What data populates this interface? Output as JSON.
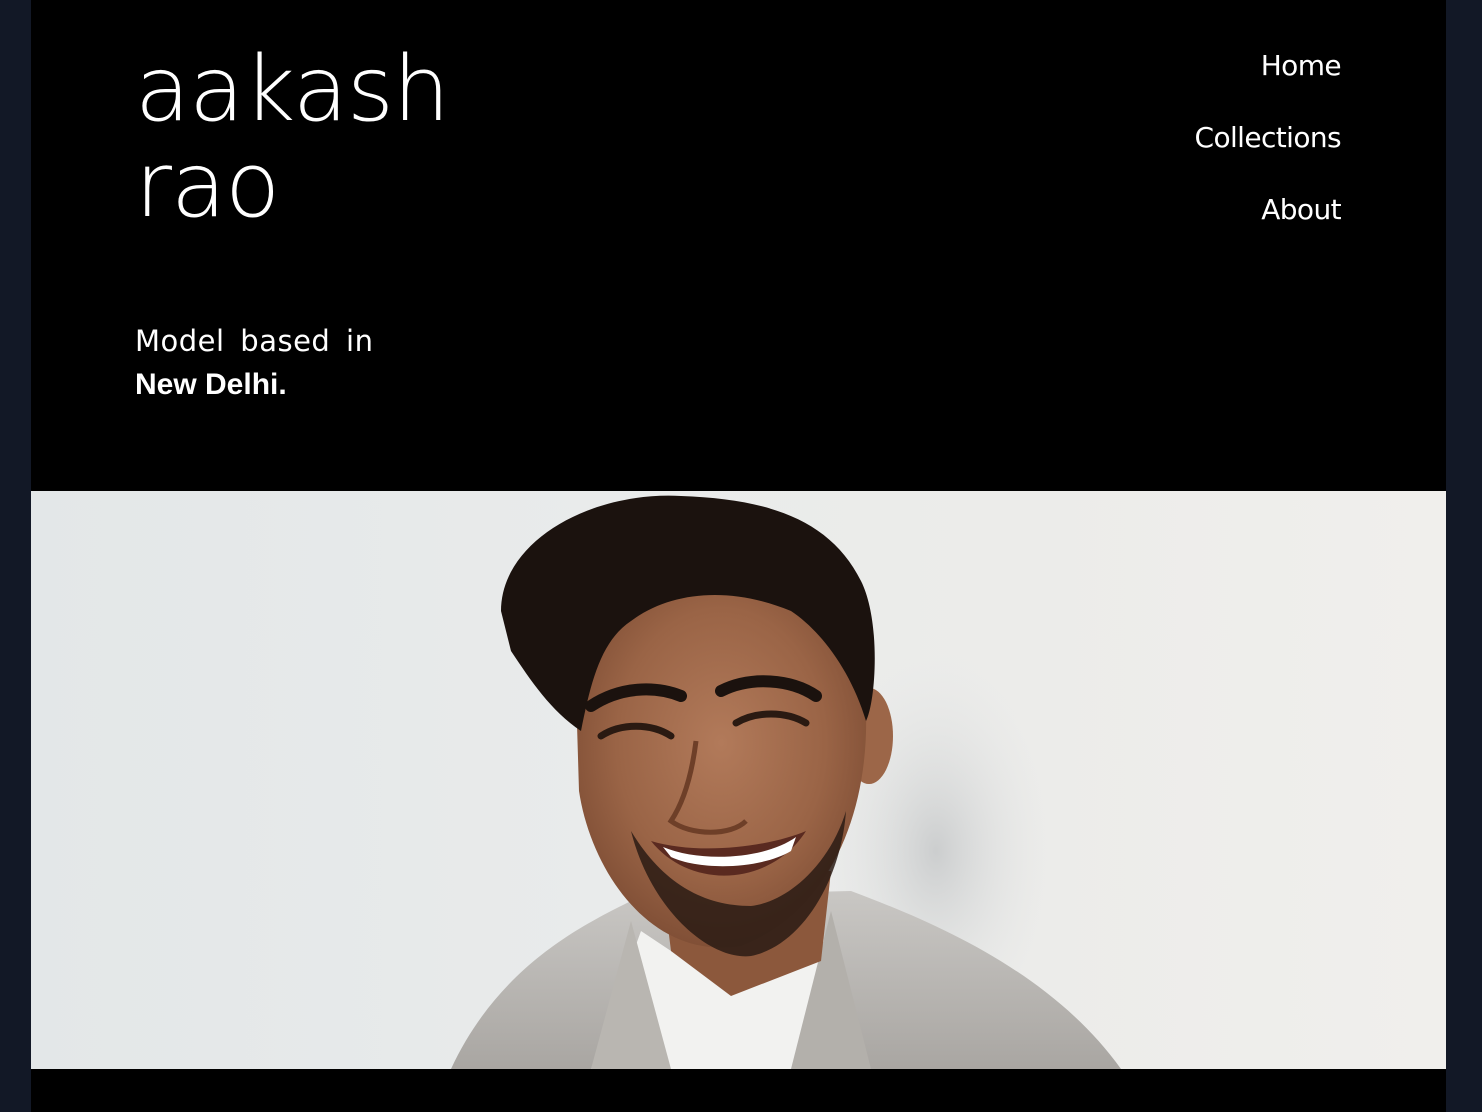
{
  "site": {
    "brand_line1": "aakash",
    "brand_line2": "rao"
  },
  "nav": {
    "items": [
      {
        "label": "Home"
      },
      {
        "label": "Collections"
      },
      {
        "label": "About"
      }
    ]
  },
  "tagline": {
    "line1": "Model based in",
    "line2": "New Delhi."
  },
  "hero": {
    "image": "portrait-photo"
  },
  "colors": {
    "page_bg": "#000000",
    "outer_bg": "#121826",
    "text": "#ffffff"
  }
}
